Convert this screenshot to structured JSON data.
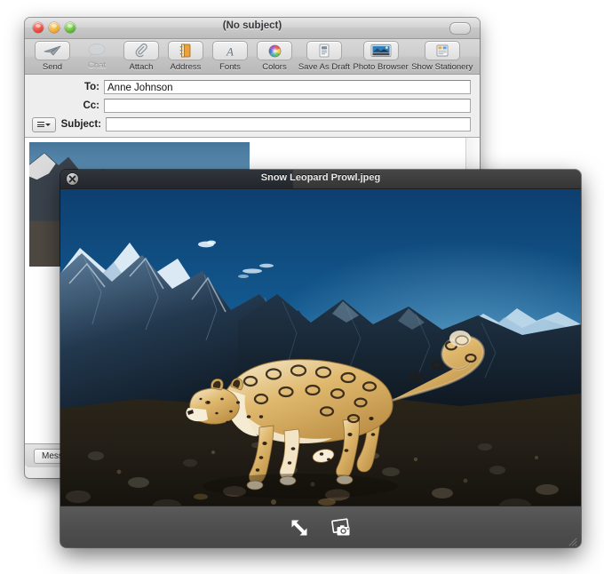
{
  "mail_window": {
    "title": "(No subject)",
    "traffic_lights": [
      {
        "name": "close",
        "color": "#e8463a"
      },
      {
        "name": "minimize",
        "color": "#f2ab32"
      },
      {
        "name": "zoom",
        "color": "#5cbb35"
      }
    ],
    "toolbar_toggle": "toolbar-toggle-pill",
    "toolbar": [
      {
        "label": "Send",
        "icon": "paper-plane-icon",
        "enabled": true
      },
      {
        "label": "Chat",
        "icon": "chat-bubble-icon",
        "enabled": false
      },
      {
        "label": "Attach",
        "icon": "paperclip-icon",
        "enabled": true
      },
      {
        "label": "Address",
        "icon": "address-book-icon",
        "enabled": true
      },
      {
        "label": "Fonts",
        "icon": "font-a-icon",
        "enabled": true
      },
      {
        "label": "Colors",
        "icon": "color-wheel-icon",
        "enabled": true
      },
      {
        "label": "Save As Draft",
        "icon": "save-draft-icon",
        "enabled": true
      },
      {
        "label": "Photo Browser",
        "icon": "photo-browser-icon",
        "enabled": true
      },
      {
        "label": "Show Stationery",
        "icon": "stationery-icon",
        "enabled": true
      }
    ],
    "headers": {
      "to_label": "To:",
      "to_value": "Anne Johnson",
      "cc_label": "Cc:",
      "cc_value": "",
      "subject_label": "Subject:",
      "subject_value": "",
      "header_menu_icon": "list-menu-dropdown-icon"
    },
    "status_bar": {
      "button_label": "Message"
    }
  },
  "preview_window": {
    "title": "Snow Leopard Prowl.jpeg",
    "close_icon": "close-x-icon",
    "toolbar": [
      {
        "label": "Full Screen",
        "icon": "expand-arrows-icon"
      },
      {
        "label": "Add to iPhoto",
        "icon": "iphoto-camera-icon"
      }
    ],
    "resize_grip": "resize-grip-icon"
  },
  "photo": {
    "subject": "Snow leopard walking across rocky mountain ridge",
    "sky_top": "#0a4f86",
    "sky_bottom": "#3fa3d6",
    "mountain_dark": "#101d2c",
    "snow": "#e8f1f8",
    "ground": "#2a2118",
    "fur_light": "#f0e2c4",
    "fur_mid": "#d9ab5e",
    "spots": "#241a10"
  }
}
